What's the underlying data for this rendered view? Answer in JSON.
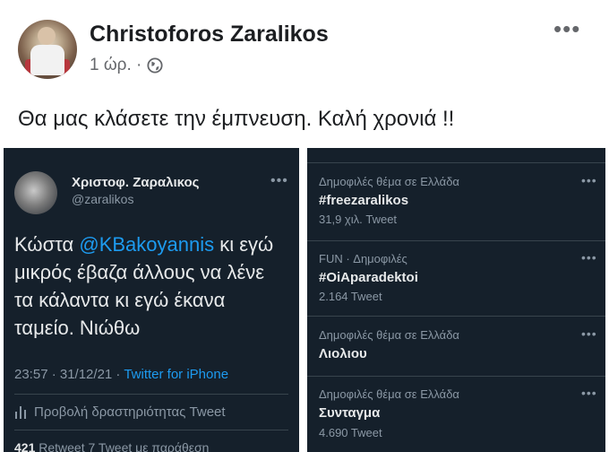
{
  "post": {
    "author": "Christoforos Zaralikos",
    "time": "1 ώρ. ·",
    "text": "Θα μας κλάσετε την έμπνευση. Καλή χρονιά !!",
    "more": "•••"
  },
  "tweet": {
    "name": "Χριστοφ. Ζαραλικος",
    "handle": "@zaralikos",
    "more": "•••",
    "text_before": "Κώστα ",
    "mention": "@KBakoyannis",
    "text_after": " κι εγώ μικρός έβαζα άλλους να λένε τα κάλαντα κι εγώ έκανα ταμείο. Νιώθω",
    "timestamp": "23:57 · 31/12/21 · ",
    "source": "Twitter for iPhone",
    "activity": "Προβολή δραστηριότητας Tweet",
    "stats_retweets": "421",
    "stats_rest": " Retweet  7 Tweet με παράθεση"
  },
  "trends": [
    {
      "context": "Δημοφιλές θέμα σε Ελλάδα",
      "name": "#freezaralikos",
      "count": "31,9 χιλ. Tweet"
    },
    {
      "context": "FUN · Δημοφιλές",
      "name": "#OiAparadektoi",
      "count": "2.164 Tweet"
    },
    {
      "context": "Δημοφιλές θέμα σε Ελλάδα",
      "name": "Λιολιου",
      "count": ""
    },
    {
      "context": "Δημοφιλές θέμα σε Ελλάδα",
      "name": "Συνταγμα",
      "count": "4.690 Tweet"
    }
  ],
  "trend_more": "•••",
  "colors": {
    "twitter_bg": "#15202b",
    "twitter_blue": "#1d9bf0",
    "fb_text": "#1c1e21"
  }
}
